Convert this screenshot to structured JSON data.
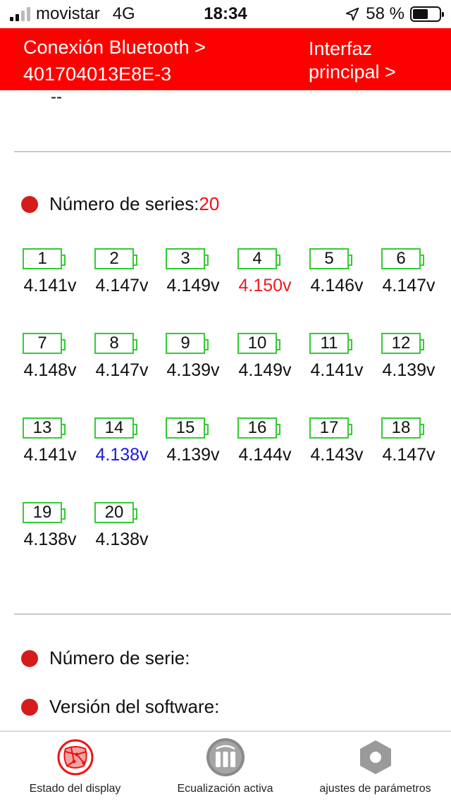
{
  "status_bar": {
    "carrier": "movistar",
    "network": "4G",
    "time": "18:34",
    "battery_percent": "58 %",
    "battery_level": 0.58
  },
  "header": {
    "bluetooth_line1": "Conexión Bluetooth >",
    "bluetooth_line2": "401704013E8E-3",
    "interface_line1": "Interfaz",
    "interface_line2": "principal >",
    "color": "#fd0000"
  },
  "top_value": "--",
  "series": {
    "label": "Número de series:",
    "count": "20"
  },
  "cells": [
    {
      "n": "1",
      "v": "4.141v"
    },
    {
      "n": "2",
      "v": "4.147v"
    },
    {
      "n": "3",
      "v": "4.149v"
    },
    {
      "n": "4",
      "v": "4.150v"
    },
    {
      "n": "5",
      "v": "4.146v"
    },
    {
      "n": "6",
      "v": "4.147v"
    },
    {
      "n": "7",
      "v": "4.148v"
    },
    {
      "n": "8",
      "v": "4.147v"
    },
    {
      "n": "9",
      "v": "4.139v"
    },
    {
      "n": "10",
      "v": "4.149v"
    },
    {
      "n": "11",
      "v": "4.141v"
    },
    {
      "n": "12",
      "v": "4.139v"
    },
    {
      "n": "13",
      "v": "4.141v"
    },
    {
      "n": "14",
      "v": "4.138v"
    },
    {
      "n": "15",
      "v": "4.139v"
    },
    {
      "n": "16",
      "v": "4.144v"
    },
    {
      "n": "17",
      "v": "4.143v"
    },
    {
      "n": "18",
      "v": "4.147v"
    },
    {
      "n": "19",
      "v": "4.138v"
    },
    {
      "n": "20",
      "v": "4.138v"
    }
  ],
  "highest_cell": "4",
  "lowest_cell": "14",
  "serial_number_label": "Número de serie:",
  "software_version_label": "Versión del software:",
  "tabs": [
    {
      "label": "Estado del display",
      "icon": "display-status-icon"
    },
    {
      "label": "Ecualización activa",
      "icon": "active-balancing-icon"
    },
    {
      "label": "ajustes de parámetros",
      "icon": "parameter-settings-icon"
    }
  ]
}
